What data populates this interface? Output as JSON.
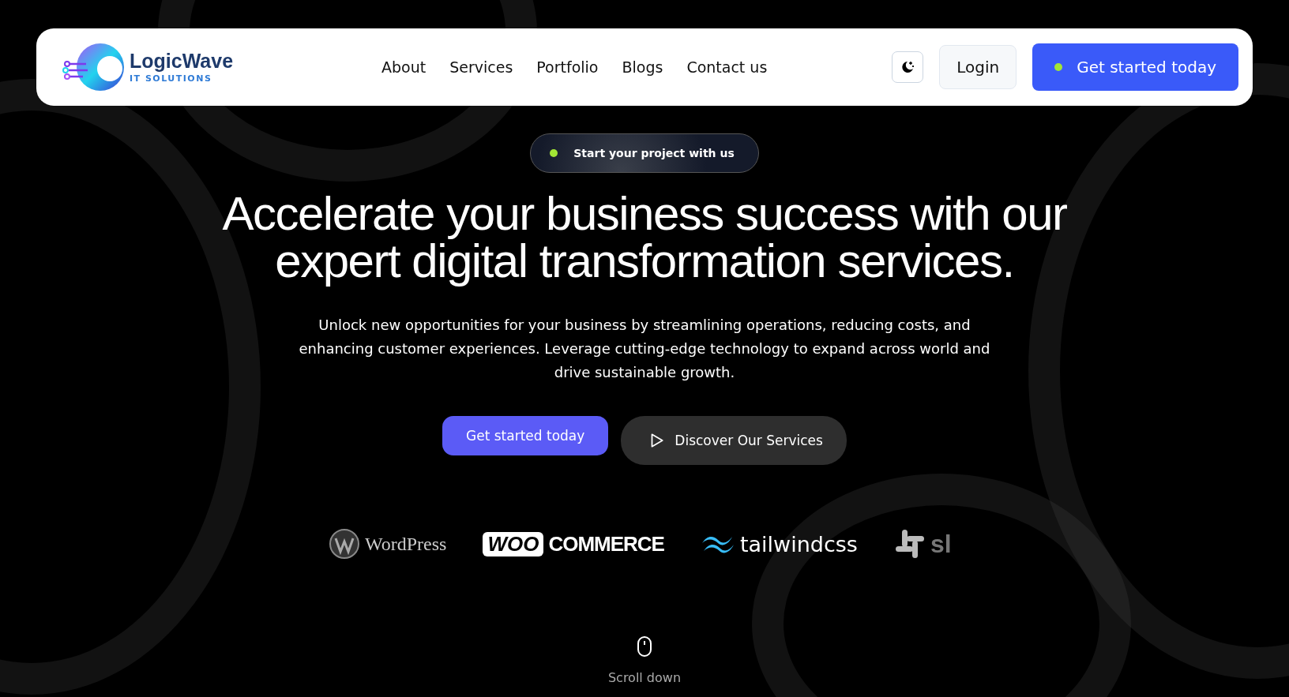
{
  "logo": {
    "name": "LogicWave",
    "tagline": "IT SOLUTIONS"
  },
  "nav": [
    "About",
    "Services",
    "Portfolio",
    "Blogs",
    "Contact us"
  ],
  "header_actions": {
    "login": "Login",
    "cta": "Get started today"
  },
  "hero": {
    "badge": "Start your project with us",
    "headline_lines": [
      "Accelerate your business success with our",
      "expert digital transformation services."
    ],
    "description": "Unlock new opportunities for your business by streamlining operations, reducing costs, and enhancing customer experiences. Leverage cutting-edge technology to expand across world and drive sustainable growth.",
    "primary_button": "Get started today",
    "secondary_button": "Discover Our Services"
  },
  "partners": [
    {
      "kind": "wordpress",
      "text": "WordPress"
    },
    {
      "kind": "woocommerce",
      "badge": "WOO",
      "text": "COMMERCE"
    },
    {
      "kind": "tailwind",
      "text": "tailwindcss"
    },
    {
      "kind": "slack",
      "text": "sl"
    }
  ],
  "scroll_hint": "Scroll down"
}
